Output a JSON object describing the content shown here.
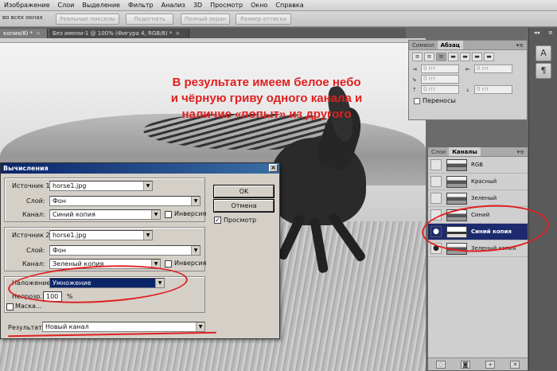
{
  "menubar": {
    "items": [
      "Изображение",
      "Слои",
      "Выделение",
      "Фильтр",
      "Анализ",
      "3D",
      "Просмотр",
      "Окно",
      "Справка"
    ]
  },
  "options": {
    "left_label": "во всех окнах",
    "buttons": [
      "Реальные пикселы",
      "Подогнать",
      "Полный экран",
      "Размер оттиска"
    ]
  },
  "doc_tabs": [
    {
      "title": "копия/8) *",
      "active": true
    },
    {
      "title": "Без имени-1 @ 100% (Фигура 4, RGB/8) *",
      "active": false
    }
  ],
  "caption": {
    "line1": "В результате имеем белое небо",
    "line2": "и чёрную гриву одного канала и",
    "line3": "наличие «попыт» из другого"
  },
  "paragraph_panel": {
    "tabs": [
      "Символ",
      "Абзац"
    ],
    "active_tab": "Абзац",
    "align_buttons": [
      "≡",
      "≡",
      "≡",
      "▬",
      "▬",
      "▬",
      "▬"
    ],
    "indent_values": [
      "0 пт",
      "0 пт",
      "0 пт",
      "0 пт",
      "0 пт"
    ],
    "hyphenation_label": "Переносы"
  },
  "channels_panel": {
    "tabs": [
      "Слои",
      "Каналы"
    ],
    "active_tab": "Каналы",
    "channels": [
      {
        "name": "RGB",
        "visible": false,
        "selected": false
      },
      {
        "name": "Красный",
        "visible": false,
        "selected": false
      },
      {
        "name": "Зеленый",
        "visible": false,
        "selected": false
      },
      {
        "name": "Синий",
        "visible": false,
        "selected": false
      },
      {
        "name": "Синий копия",
        "visible": true,
        "selected": true
      },
      {
        "name": "Зеленый копия",
        "visible": true,
        "selected": false
      }
    ]
  },
  "dialog": {
    "title": "Вычисления",
    "source1": {
      "label": "Источник 1:",
      "file": "horse1.jpg",
      "layer_label": "Слой:",
      "layer": "Фон",
      "channel_label": "Канал:",
      "channel": "Синий копия",
      "invert_label": "Инверсия"
    },
    "source2": {
      "label": "Источник 2:",
      "file": "horse1.jpg",
      "layer_label": "Слой:",
      "layer": "Фон",
      "channel_label": "Канал:",
      "channel": "Зеленый копия",
      "invert_label": "Инверсия"
    },
    "blending_label": "Наложение:",
    "blending": "Умножение",
    "opacity_label": "Непрозр.:",
    "opacity": "100",
    "opacity_unit": "%",
    "mask_label": "Маска...",
    "result_label": "Результат:",
    "result": "Новый канал",
    "ok": "OK",
    "cancel": "Отмена",
    "preview_label": "Просмотр",
    "preview_checked": true
  },
  "colors": {
    "annotation_red": "#e02020",
    "selection_blue": "#0a246a"
  }
}
